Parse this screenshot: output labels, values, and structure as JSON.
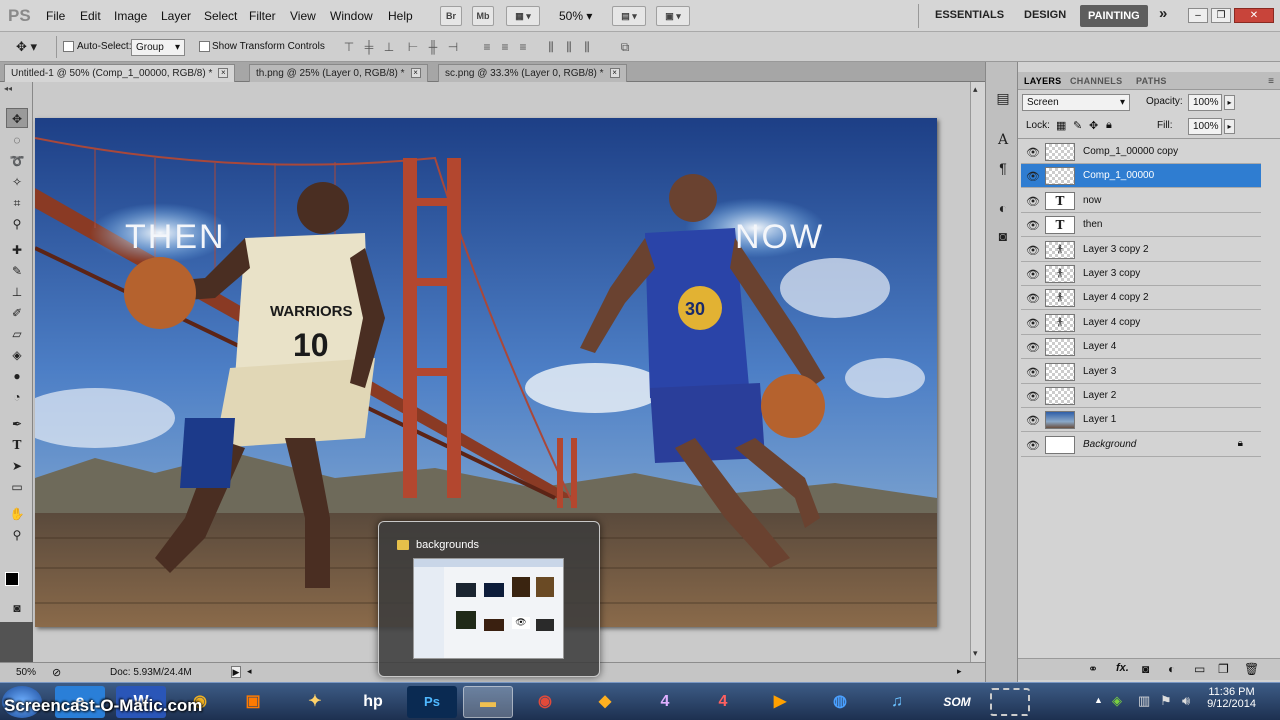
{
  "app": {
    "logo": "PS",
    "colors": {
      "accent": "#2f7dd1",
      "chrome": "#d6d6d6",
      "taskbar": "#1d3050"
    }
  },
  "menu": {
    "items": [
      "File",
      "Edit",
      "Image",
      "Layer",
      "Select",
      "Filter",
      "View",
      "Window",
      "Help"
    ]
  },
  "appbar": {
    "bridge_label": "Br",
    "minibridge_label": "Mb",
    "zoom": "50%"
  },
  "workspaces": {
    "items": [
      "ESSENTIALS",
      "DESIGN",
      "PAINTING"
    ],
    "active": "PAINTING",
    "more": "»"
  },
  "options": {
    "auto_select_label": "Auto-Select:",
    "auto_select_value": "Group",
    "transform_label": "Show Transform Controls"
  },
  "doc_tabs": [
    {
      "label": "Untitled-1 @ 50% (Comp_1_00000, RGB/8) *",
      "close": "×"
    },
    {
      "label": "th.png @ 25% (Layer 0, RGB/8) *",
      "close": "×"
    },
    {
      "label": "sc.png @ 33.3% (Layer 0, RGB/8) *",
      "close": "×"
    }
  ],
  "canvas": {
    "text_then": "THEN",
    "text_now": "NOW",
    "jersey_left_team": "WARRIORS",
    "jersey_left_number": "10",
    "jersey_right_number": "30"
  },
  "status": {
    "zoom": "50%",
    "doc": "Doc: 5.93M/24.4M"
  },
  "layers_panel": {
    "tabs": [
      "LAYERS",
      "CHANNELS",
      "PATHS"
    ],
    "blend_mode": "Screen",
    "opacity_label": "Opacity:",
    "opacity_value": "100%",
    "lock_label": "Lock:",
    "fill_label": "Fill:",
    "fill_value": "100%",
    "layers": [
      {
        "name": "Comp_1_00000 copy",
        "thumb": "trans",
        "selected": false
      },
      {
        "name": "Comp_1_00000",
        "thumb": "trans",
        "selected": true
      },
      {
        "name": "now",
        "thumb": "text",
        "selected": false
      },
      {
        "name": "then",
        "thumb": "text",
        "selected": false
      },
      {
        "name": "Layer 3 copy 2",
        "thumb": "player",
        "selected": false
      },
      {
        "name": "Layer 3 copy",
        "thumb": "player",
        "selected": false
      },
      {
        "name": "Layer 4 copy 2",
        "thumb": "player",
        "selected": false
      },
      {
        "name": "Layer 4 copy",
        "thumb": "player",
        "selected": false
      },
      {
        "name": "Layer 4",
        "thumb": "trans",
        "selected": false
      },
      {
        "name": "Layer 3",
        "thumb": "trans",
        "selected": false
      },
      {
        "name": "Layer 2",
        "thumb": "trans",
        "selected": false
      },
      {
        "name": "Layer 1",
        "thumb": "photo",
        "selected": false
      },
      {
        "name": "Background",
        "thumb": "white",
        "selected": false,
        "locked": true
      }
    ],
    "footer_icons": [
      "link-icon",
      "fx-icon",
      "mask-icon",
      "adjustment-icon",
      "folder-icon",
      "new-layer-icon",
      "trash-icon"
    ]
  },
  "popup": {
    "title": "backgrounds"
  },
  "taskbar": {
    "watermark": "Screencast-O-Matic.com",
    "time": "11:36 PM",
    "date": "9/12/2014",
    "ps_label": "Ps",
    "som_label": "SOM"
  }
}
